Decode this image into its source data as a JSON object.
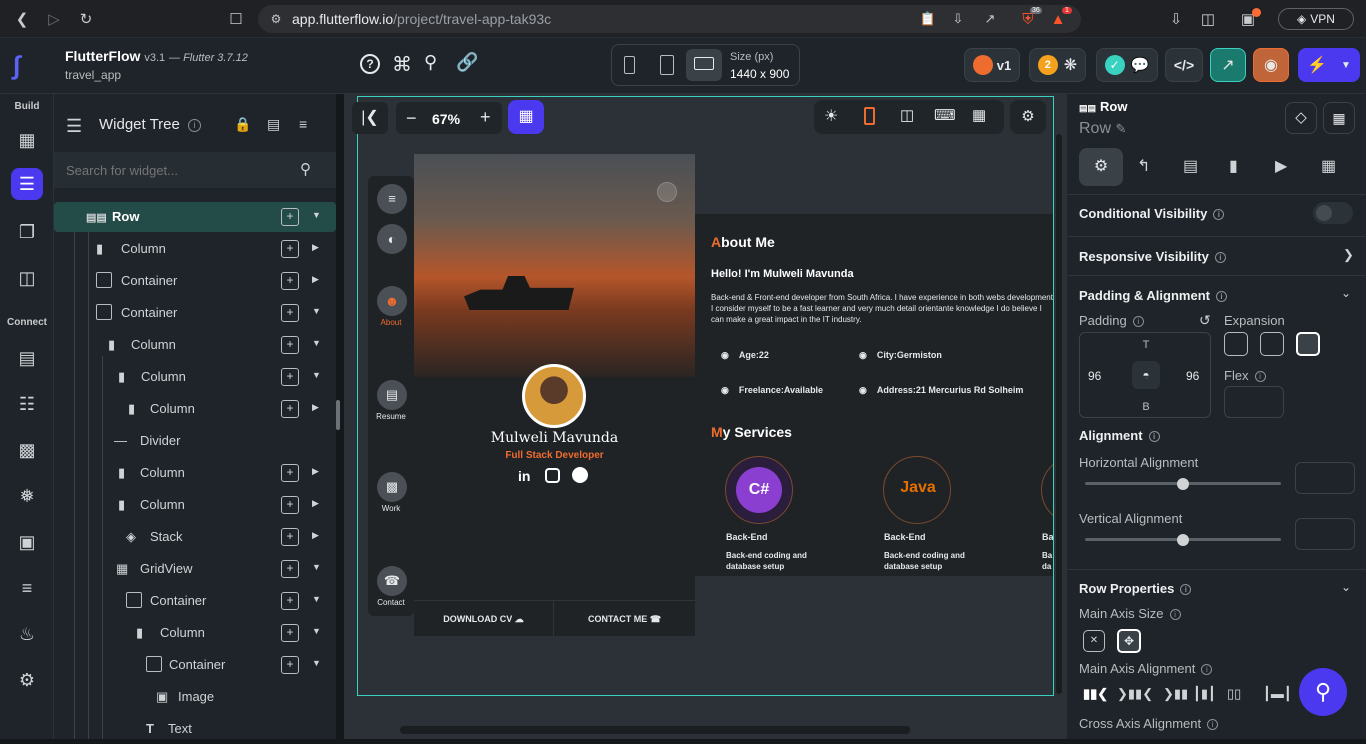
{
  "browser": {
    "url_host": "app.flutterflow.io",
    "url_path": "/project/travel-app-tak93c",
    "vpn_label": "VPN",
    "brave_badge": "36",
    "alert_badge": "1"
  },
  "app": {
    "name": "FlutterFlow",
    "version": "v3.1",
    "flutter_version": "— Flutter 3.7.12",
    "project": "travel_app",
    "size_label": "Size (px)",
    "size_value": "1440 x 900",
    "version_badge": "v1",
    "issues_count": "2"
  },
  "leftnav": {
    "build_label": "Build",
    "connect_label": "Connect"
  },
  "tree": {
    "title": "Widget Tree",
    "search_placeholder": "Search for widget...",
    "items": [
      {
        "label": "Row",
        "icon": "row-icon"
      },
      {
        "label": "Column",
        "icon": "column-icon"
      },
      {
        "label": "Container",
        "icon": "container-icon"
      },
      {
        "label": "Container",
        "icon": "container-icon"
      },
      {
        "label": "Column",
        "icon": "column-icon"
      },
      {
        "label": "Column",
        "icon": "column-icon"
      },
      {
        "label": "Column",
        "icon": "column-icon"
      },
      {
        "label": "Divider",
        "icon": "divider-icon"
      },
      {
        "label": "Column",
        "icon": "column-icon"
      },
      {
        "label": "Column",
        "icon": "column-icon"
      },
      {
        "label": "Stack",
        "icon": "stack-icon"
      },
      {
        "label": "GridView",
        "icon": "gridview-icon"
      },
      {
        "label": "Container",
        "icon": "container-icon"
      },
      {
        "label": "Column",
        "icon": "column-icon"
      },
      {
        "label": "Container",
        "icon": "container-icon"
      },
      {
        "label": "Image",
        "icon": "image-icon"
      },
      {
        "label": "Text",
        "icon": "text-icon"
      }
    ]
  },
  "canvas": {
    "zoom": "67%"
  },
  "site": {
    "nav": [
      "About",
      "Resume",
      "Work",
      "Contact"
    ],
    "name": "Mulweli Mavunda",
    "role": "Full Stack Developer",
    "download_cv": "DOWNLOAD CV",
    "contact_me": "CONTACT ME",
    "about_title_first": "A",
    "about_title_rest": "bout Me",
    "hello": "Hello! I'm Mulweli Mavunda",
    "bio": "Back-end & Front-end developer from South Africa. I have experience in both webs development. I consider myself to be a fast learner and very much detail orientante knowledge I do believe I can make a great impact in the IT industry.",
    "age": "Age:22",
    "city": "City:Germiston",
    "freelance": "Freelance:Available",
    "address": "Address:21 Mercurius Rd Solheim",
    "services_title_first": "M",
    "services_title_rest": "y Services",
    "services": [
      {
        "title": "Back-End",
        "desc": "Back-end coding and database setup",
        "logo": "C#"
      },
      {
        "title": "Back-End",
        "desc": "Back-end coding and database setup",
        "logo": "Java"
      },
      {
        "title": "Ba",
        "desc": "Ba da",
        "logo": ""
      }
    ]
  },
  "right": {
    "widget": "Row",
    "widget_name": "Row",
    "conditional_visibility": "Conditional Visibility",
    "responsive_visibility": "Responsive Visibility",
    "padding_alignment": "Padding & Alignment",
    "padding": "Padding",
    "expansion": "Expansion",
    "pad_top": "T",
    "pad_left": "96",
    "pad_right": "96",
    "pad_bottom": "B",
    "flex": "Flex",
    "alignment": "Alignment",
    "horizontal_alignment": "Horizontal Alignment",
    "vertical_alignment": "Vertical Alignment",
    "row_properties": "Row Properties",
    "main_axis_size": "Main Axis Size",
    "main_axis_alignment": "Main Axis Alignment",
    "cross_axis_alignment": "Cross Axis Alignment"
  },
  "colors": {
    "accent": "#4b39ef",
    "teal": "#39d2c0",
    "orange": "#ef6c2f"
  }
}
